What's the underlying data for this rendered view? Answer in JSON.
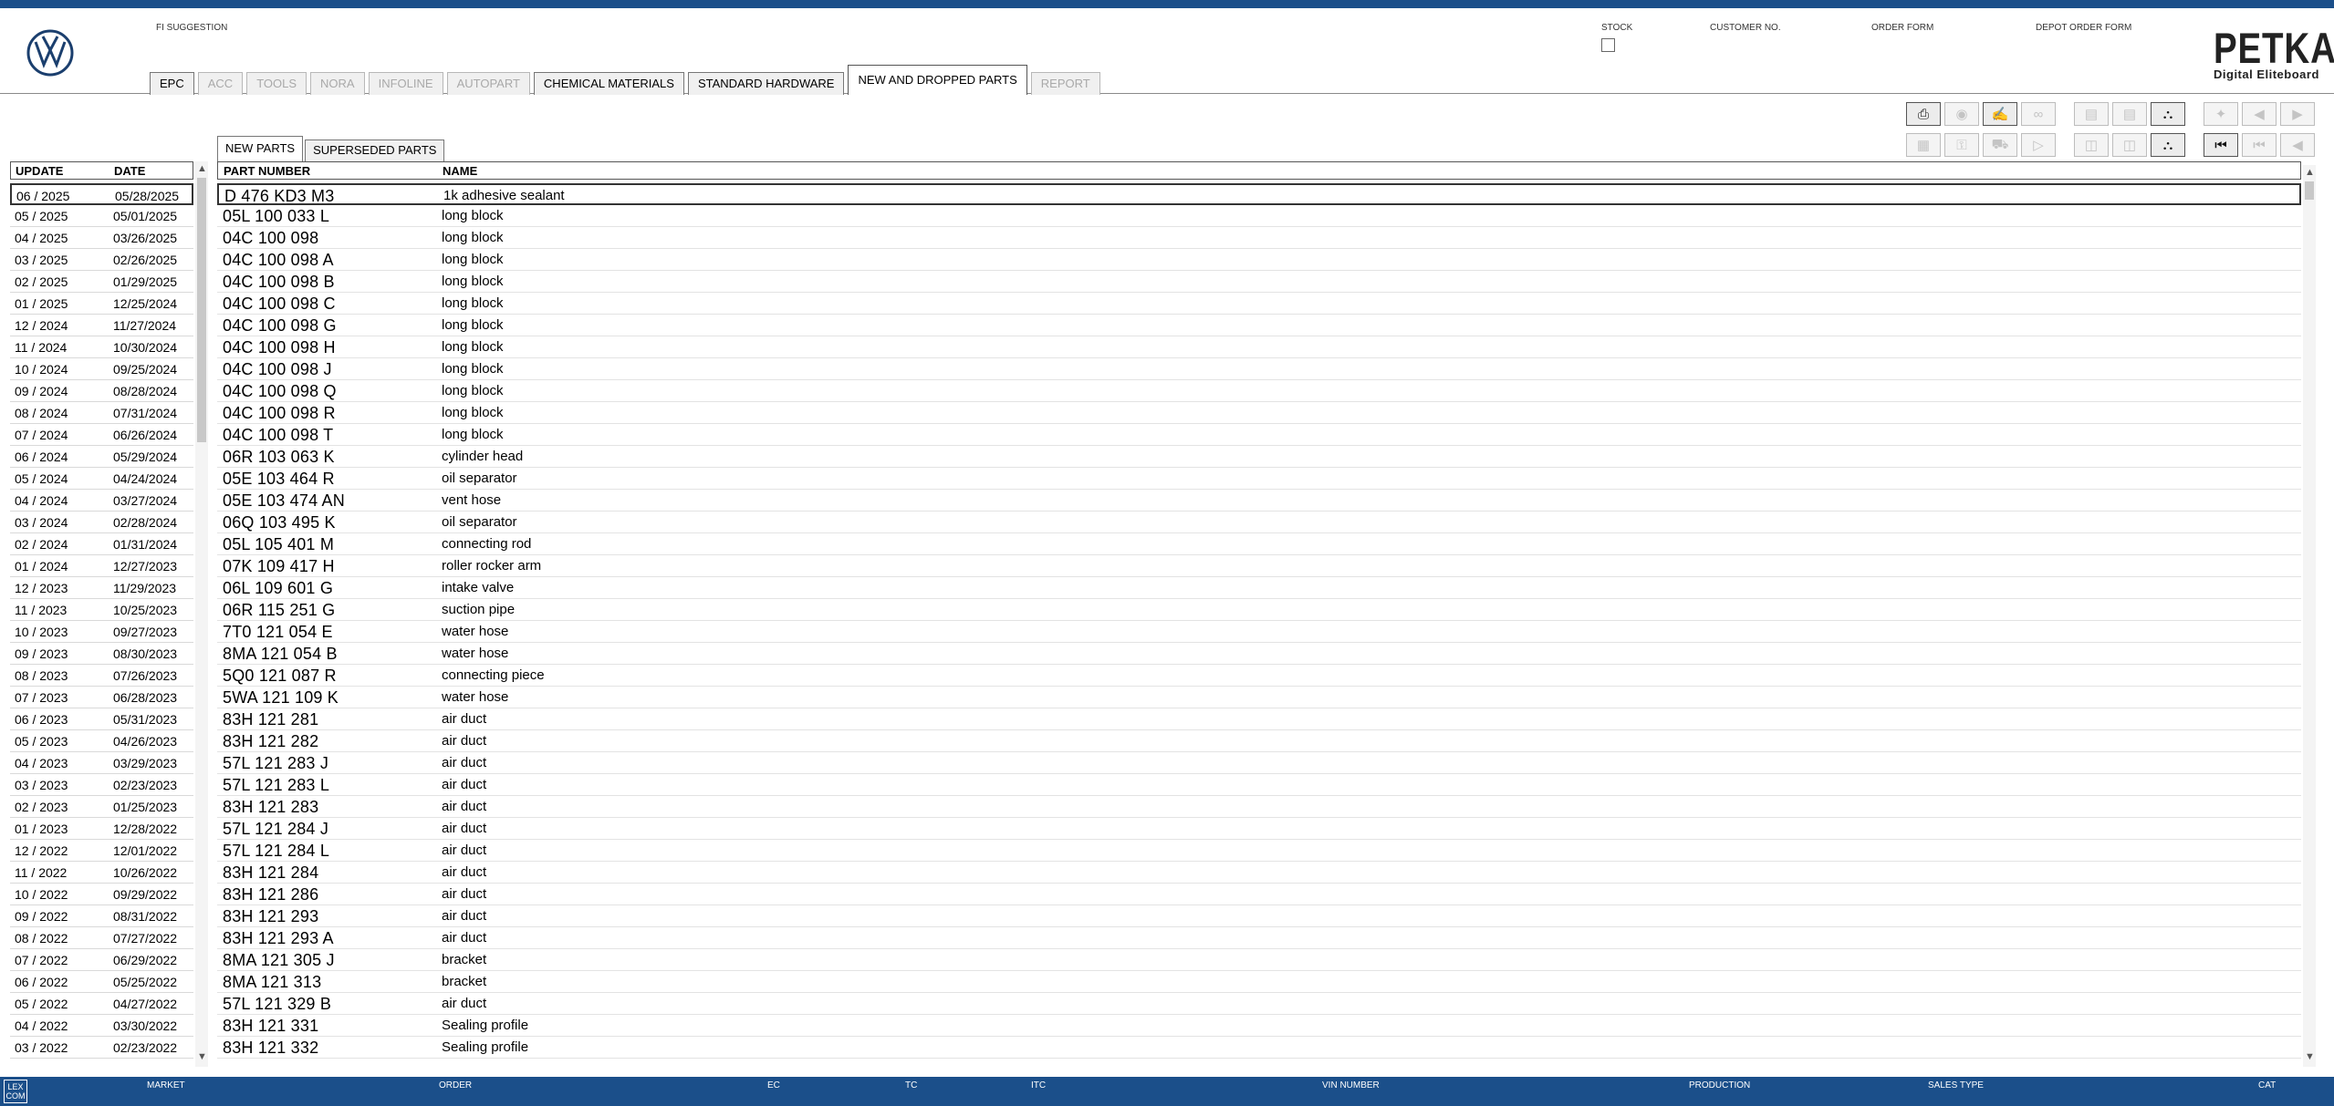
{
  "header": {
    "fi_suggestion": "FI SUGGESTION",
    "stock": "STOCK",
    "customer_no": "CUSTOMER NO.",
    "order_form": "ORDER FORM",
    "depot_order_form": "DEPOT ORDER FORM",
    "brand_title": "PETKA",
    "brand_subtitle": "Digital Eliteboard"
  },
  "main_tabs": [
    {
      "label": "EPC",
      "state": "enabled"
    },
    {
      "label": "ACC",
      "state": "disabled"
    },
    {
      "label": "TOOLS",
      "state": "disabled"
    },
    {
      "label": "NORA",
      "state": "disabled"
    },
    {
      "label": "INFOLINE",
      "state": "disabled"
    },
    {
      "label": "AUTOPART",
      "state": "disabled"
    },
    {
      "label": "CHEMICAL MATERIALS",
      "state": "enabled"
    },
    {
      "label": "STANDARD HARDWARE",
      "state": "enabled"
    },
    {
      "label": "NEW AND DROPPED PARTS",
      "state": "active"
    },
    {
      "label": "REPORT",
      "state": "disabled"
    }
  ],
  "sub_tabs": [
    {
      "label": "NEW PARTS",
      "state": "active"
    },
    {
      "label": "SUPERSEDED PARTS",
      "state": "enabled"
    }
  ],
  "date_table": {
    "headers": {
      "update": "UPDATE",
      "date": "DATE"
    },
    "rows": [
      {
        "update": "06 / 2025",
        "date": "05/28/2025"
      },
      {
        "update": "05 / 2025",
        "date": "05/01/2025"
      },
      {
        "update": "04 / 2025",
        "date": "03/26/2025"
      },
      {
        "update": "03 / 2025",
        "date": "02/26/2025"
      },
      {
        "update": "02 / 2025",
        "date": "01/29/2025"
      },
      {
        "update": "01 / 2025",
        "date": "12/25/2024"
      },
      {
        "update": "12 / 2024",
        "date": "11/27/2024"
      },
      {
        "update": "11 / 2024",
        "date": "10/30/2024"
      },
      {
        "update": "10 / 2024",
        "date": "09/25/2024"
      },
      {
        "update": "09 / 2024",
        "date": "08/28/2024"
      },
      {
        "update": "08 / 2024",
        "date": "07/31/2024"
      },
      {
        "update": "07 / 2024",
        "date": "06/26/2024"
      },
      {
        "update": "06 / 2024",
        "date": "05/29/2024"
      },
      {
        "update": "05 / 2024",
        "date": "04/24/2024"
      },
      {
        "update": "04 / 2024",
        "date": "03/27/2024"
      },
      {
        "update": "03 / 2024",
        "date": "02/28/2024"
      },
      {
        "update": "02 / 2024",
        "date": "01/31/2024"
      },
      {
        "update": "01 / 2024",
        "date": "12/27/2023"
      },
      {
        "update": "12 / 2023",
        "date": "11/29/2023"
      },
      {
        "update": "11 / 2023",
        "date": "10/25/2023"
      },
      {
        "update": "10 / 2023",
        "date": "09/27/2023"
      },
      {
        "update": "09 / 2023",
        "date": "08/30/2023"
      },
      {
        "update": "08 / 2023",
        "date": "07/26/2023"
      },
      {
        "update": "07 / 2023",
        "date": "06/28/2023"
      },
      {
        "update": "06 / 2023",
        "date": "05/31/2023"
      },
      {
        "update": "05 / 2023",
        "date": "04/26/2023"
      },
      {
        "update": "04 / 2023",
        "date": "03/29/2023"
      },
      {
        "update": "03 / 2023",
        "date": "02/23/2023"
      },
      {
        "update": "02 / 2023",
        "date": "01/25/2023"
      },
      {
        "update": "01 / 2023",
        "date": "12/28/2022"
      },
      {
        "update": "12 / 2022",
        "date": "12/01/2022"
      },
      {
        "update": "11 / 2022",
        "date": "10/26/2022"
      },
      {
        "update": "10 / 2022",
        "date": "09/29/2022"
      },
      {
        "update": "09 / 2022",
        "date": "08/31/2022"
      },
      {
        "update": "08 / 2022",
        "date": "07/27/2022"
      },
      {
        "update": "07 / 2022",
        "date": "06/29/2022"
      },
      {
        "update": "06 / 2022",
        "date": "05/25/2022"
      },
      {
        "update": "05 / 2022",
        "date": "04/27/2022"
      },
      {
        "update": "04 / 2022",
        "date": "03/30/2022"
      },
      {
        "update": "03 / 2022",
        "date": "02/23/2022"
      }
    ]
  },
  "parts_table": {
    "headers": {
      "part_number": "PART NUMBER",
      "name": "NAME"
    },
    "rows": [
      {
        "part_number": "D  476 KD3 M3",
        "name": "1k adhesive sealant"
      },
      {
        "part_number": "05L 100 033 L",
        "name": "long block"
      },
      {
        "part_number": "04C 100 098",
        "name": "long block"
      },
      {
        "part_number": "04C 100 098 A",
        "name": "long block"
      },
      {
        "part_number": "04C 100 098 B",
        "name": "long block"
      },
      {
        "part_number": "04C 100 098 C",
        "name": "long block"
      },
      {
        "part_number": "04C 100 098 G",
        "name": "long block"
      },
      {
        "part_number": "04C 100 098 H",
        "name": "long block"
      },
      {
        "part_number": "04C 100 098 J",
        "name": "long block"
      },
      {
        "part_number": "04C 100 098 Q",
        "name": "long block"
      },
      {
        "part_number": "04C 100 098 R",
        "name": "long block"
      },
      {
        "part_number": "04C 100 098 T",
        "name": "long block"
      },
      {
        "part_number": "06R 103 063 K",
        "name": "cylinder head"
      },
      {
        "part_number": "05E 103 464 R",
        "name": "oil separator"
      },
      {
        "part_number": "05E 103 474 AN",
        "name": "vent hose"
      },
      {
        "part_number": "06Q 103 495 K",
        "name": "oil separator"
      },
      {
        "part_number": "05L 105 401 M",
        "name": "connecting rod"
      },
      {
        "part_number": "07K 109 417 H",
        "name": "roller rocker arm"
      },
      {
        "part_number": "06L 109 601 G",
        "name": "intake valve"
      },
      {
        "part_number": "06R 115 251 G",
        "name": "suction pipe"
      },
      {
        "part_number": "7T0 121 054 E",
        "name": "water hose"
      },
      {
        "part_number": "8MA 121 054 B",
        "name": "water hose"
      },
      {
        "part_number": "5Q0 121 087 R",
        "name": "connecting piece"
      },
      {
        "part_number": "5WA 121 109 K",
        "name": "water hose"
      },
      {
        "part_number": "83H 121 281",
        "name": "air duct"
      },
      {
        "part_number": "83H 121 282",
        "name": "air duct"
      },
      {
        "part_number": "57L 121 283 J",
        "name": "air duct"
      },
      {
        "part_number": "57L 121 283 L",
        "name": "air duct"
      },
      {
        "part_number": "83H 121 283",
        "name": "air duct"
      },
      {
        "part_number": "57L 121 284 J",
        "name": "air duct"
      },
      {
        "part_number": "57L 121 284 L",
        "name": "air duct"
      },
      {
        "part_number": "83H 121 284",
        "name": "air duct"
      },
      {
        "part_number": "83H 121 286",
        "name": "air duct"
      },
      {
        "part_number": "83H 121 293",
        "name": "air duct"
      },
      {
        "part_number": "83H 121 293 A",
        "name": "air duct"
      },
      {
        "part_number": "8MA 121 305 J",
        "name": "bracket"
      },
      {
        "part_number": "8MA 121 313",
        "name": "bracket"
      },
      {
        "part_number": "57L 121 329 B",
        "name": "air duct"
      },
      {
        "part_number": "83H 121 331",
        "name": "Sealing profile"
      },
      {
        "part_number": "83H 121 332",
        "name": "Sealing profile"
      }
    ]
  },
  "footer": {
    "logo": "LEX COM",
    "market": "MARKET",
    "order": "ORDER",
    "ec": "EC",
    "tc": "TC",
    "itc": "ITC",
    "vin_number": "VIN NUMBER",
    "production": "PRODUCTION",
    "sales_type": "SALES TYPE",
    "cat": "CAT"
  },
  "colors": {
    "brand_blue": "#1b4f8a",
    "selected_border": "#333333",
    "disabled_text": "#a9a9a9"
  },
  "icons": [
    "vw-logo",
    "print-icon",
    "stamp-icon",
    "handshake-icon",
    "glasses-icon",
    "stock-icon",
    "depot-icon",
    "cart-icon",
    "pin-icon",
    "prev-page-icon",
    "next-page-icon",
    "table-icon",
    "key-icon",
    "car-icon",
    "step-icon",
    "split-icon",
    "transfer-icon",
    "cart-plus-icon",
    "first-icon",
    "previous-icon",
    "back-icon"
  ]
}
